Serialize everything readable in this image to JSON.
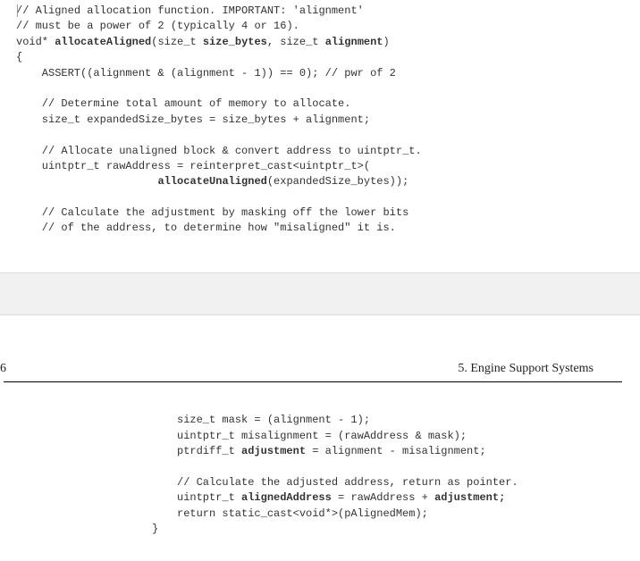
{
  "page1": {
    "code": {
      "c1a": "/",
      "c1b": "/ Aligned allocation function. IMPORTANT: 'alignment'",
      "c2": "// must be a power of 2 (typically 4 or 16).",
      "sig1": "void* ",
      "sig2": "allocateAligned",
      "sig3": "(size_t ",
      "sig4": "size_bytes",
      "sig5": ", size_t ",
      "sig6": "alignment",
      "sig7": ")",
      "brace": "{",
      "l1": "    ASSERT((alignment & (alignment - 1)) == 0); // pwr of 2",
      "blank1": "",
      "c3": "    // Determine total amount of memory to allocate.",
      "l2": "    size_t expandedSize_bytes = size_bytes + alignment;",
      "blank2": "",
      "c4": "    // Allocate unaligned block & convert address to uintptr_t.",
      "l3": "    uintptr_t rawAddress = reinterpret_cast<uintptr_t>(",
      "l4a": "                      ",
      "l4b": "allocateUnaligned",
      "l4c": "(expandedSize_bytes));",
      "blank3": "",
      "c5": "    // Calculate the adjustment by masking off the lower bits",
      "c6": "    // of the address, to determine how \"misaligned\" it is."
    }
  },
  "page2": {
    "header_left": "6",
    "header_right": "5. Engine Support Systems",
    "code": {
      "l1": "size_t mask = (alignment - 1);",
      "l2": "uintptr_t misalignment = (rawAddress & mask);",
      "l3a": "ptrdiff_t ",
      "l3b": "adjustment",
      "l3c": " = alignment - misalignment;",
      "blank": "",
      "c1": "// Calculate the adjusted address, return as pointer.",
      "l4a": "uintptr_t ",
      "l4b": "alignedAddress",
      "l4c": " = rawAddress + ",
      "l4d": "adjustment;",
      "l5": "return static_cast<void*>(pAlignedMem);",
      "brace": "}"
    }
  }
}
